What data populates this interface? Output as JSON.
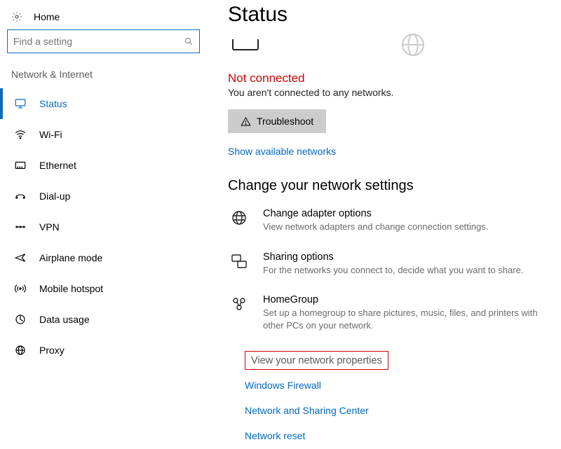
{
  "sidebar": {
    "home": "Home",
    "search_placeholder": "Find a setting",
    "category": "Network & Internet",
    "items": [
      {
        "label": "Status",
        "selected": true
      },
      {
        "label": "Wi-Fi"
      },
      {
        "label": "Ethernet"
      },
      {
        "label": "Dial-up"
      },
      {
        "label": "VPN"
      },
      {
        "label": "Airplane mode"
      },
      {
        "label": "Mobile hotspot"
      },
      {
        "label": "Data usage"
      },
      {
        "label": "Proxy"
      }
    ]
  },
  "main": {
    "title": "Status",
    "not_connected": "Not connected",
    "sub_msg": "You aren't connected to any networks.",
    "troubleshoot": "Troubleshoot",
    "show_networks": "Show available networks",
    "section": "Change your network settings",
    "opts": [
      {
        "title": "Change adapter options",
        "desc": "View network adapters and change connection settings."
      },
      {
        "title": "Sharing options",
        "desc": "For the networks you connect to, decide what you want to share."
      },
      {
        "title": "HomeGroup",
        "desc": "Set up a homegroup to share pictures, music, files, and printers with other PCs on your network."
      }
    ],
    "highlight": "View your network properties",
    "links": [
      "Windows Firewall",
      "Network and Sharing Center",
      "Network reset"
    ]
  }
}
